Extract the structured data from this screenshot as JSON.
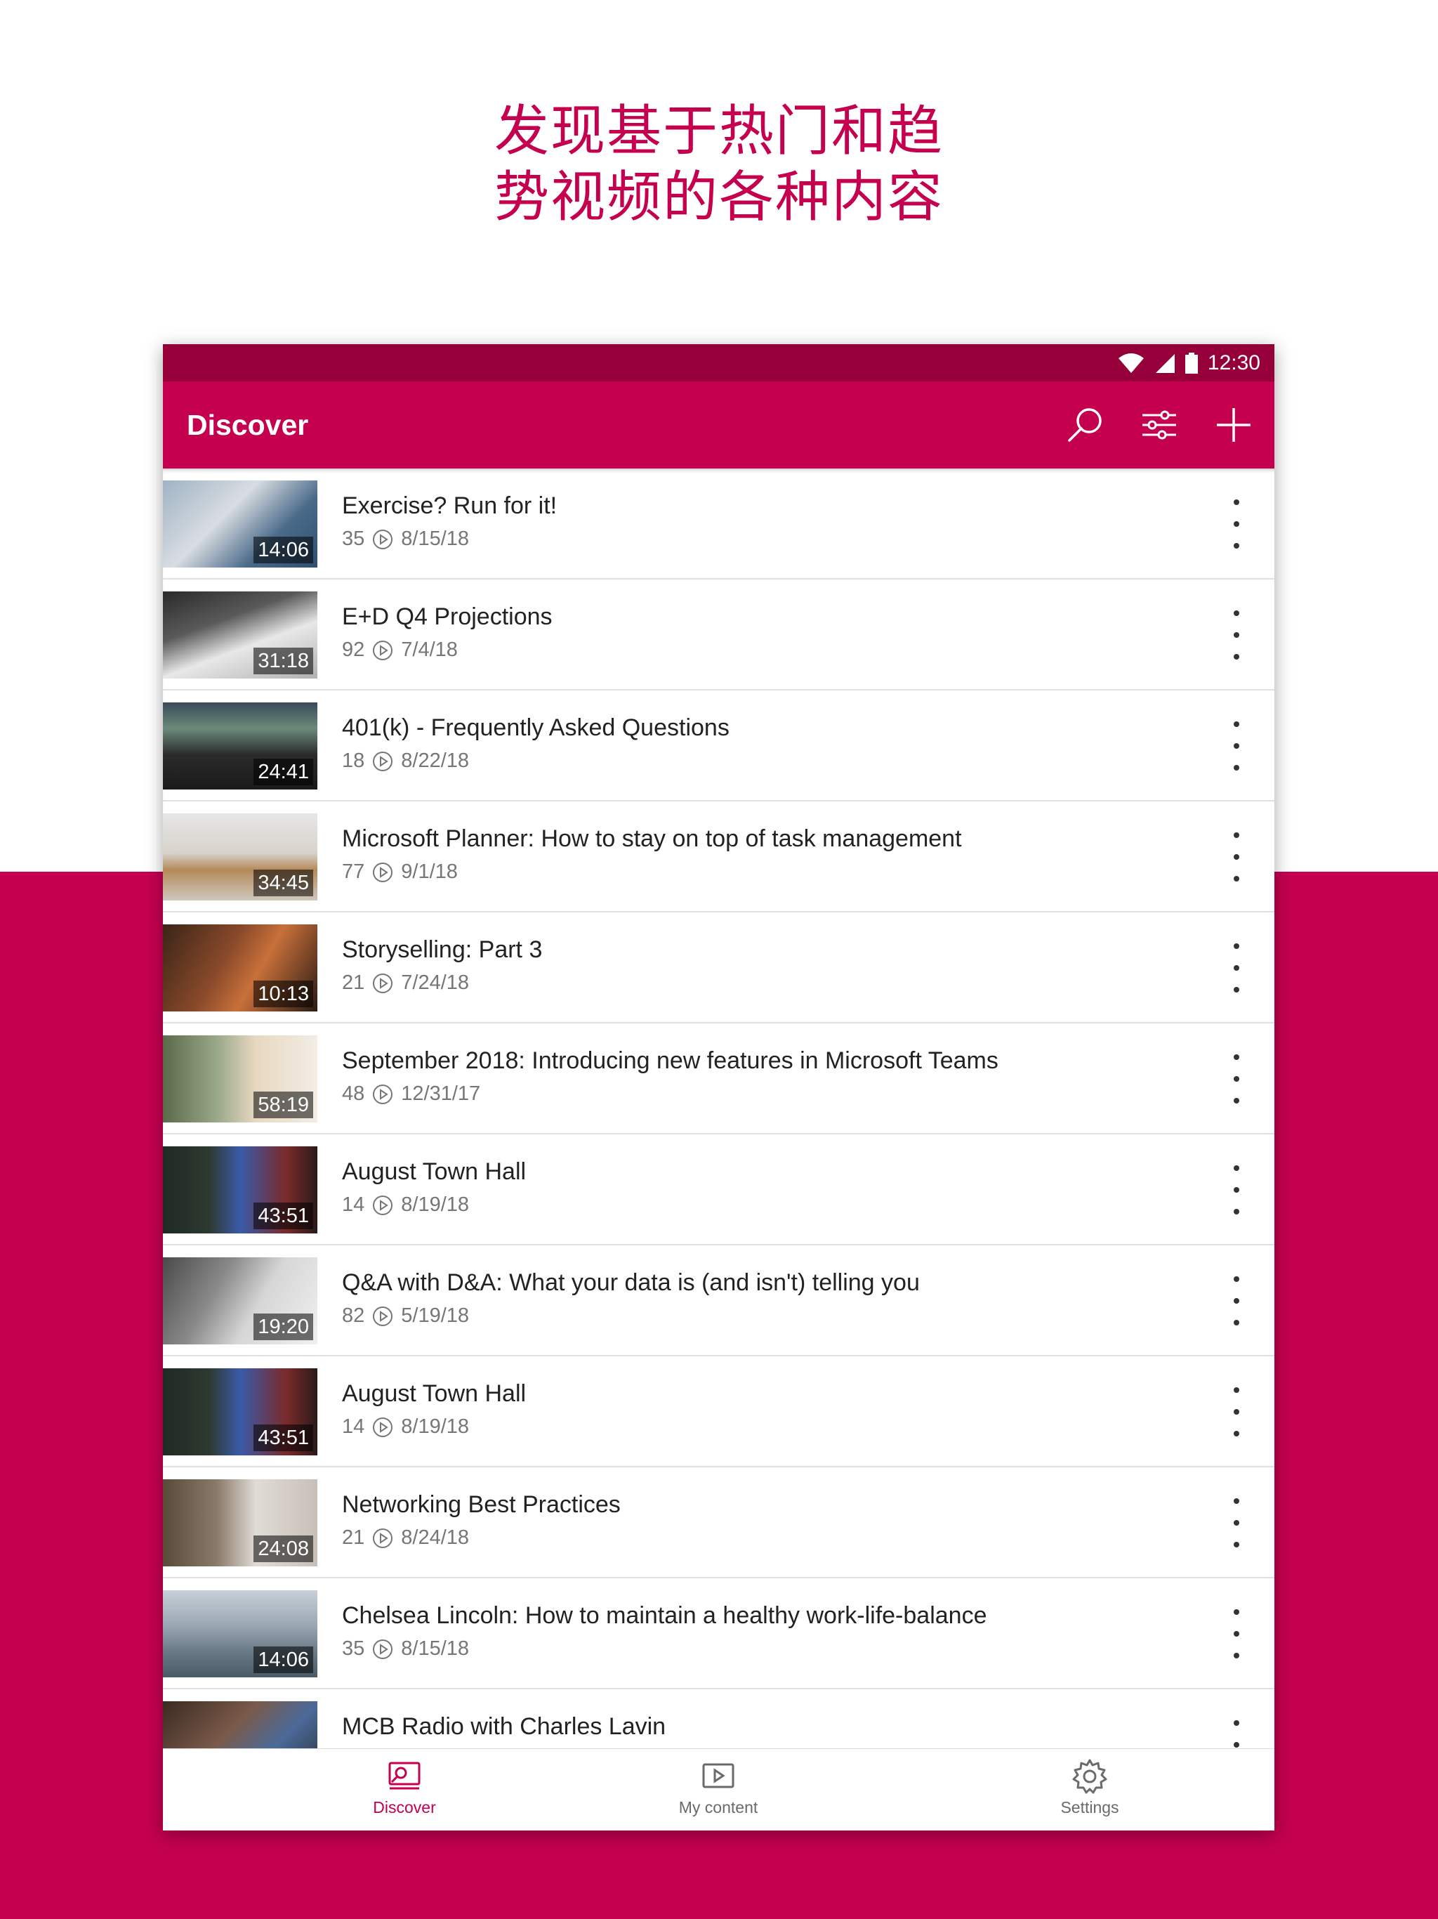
{
  "headline": {
    "line1": "发现基于热门和趋",
    "line2": "势视频的各种内容"
  },
  "status_bar": {
    "time": "12:30"
  },
  "app_bar": {
    "title": "Discover"
  },
  "videos": [
    {
      "title": "Exercise? Run for it!",
      "views": "35",
      "date": "8/15/18",
      "duration": "14:06"
    },
    {
      "title": "E+D Q4 Projections",
      "views": "92",
      "date": "7/4/18",
      "duration": "31:18"
    },
    {
      "title": "401(k) - Frequently Asked Questions",
      "views": "18",
      "date": "8/22/18",
      "duration": "24:41"
    },
    {
      "title": "Microsoft Planner: How to stay on top of task management",
      "views": "77",
      "date": "9/1/18",
      "duration": "34:45"
    },
    {
      "title": "Storyselling: Part 3",
      "views": "21",
      "date": "7/24/18",
      "duration": "10:13"
    },
    {
      "title": "September 2018: Introducing new features in Microsoft Teams",
      "views": "48",
      "date": "12/31/17",
      "duration": "58:19"
    },
    {
      "title": "August Town Hall",
      "views": "14",
      "date": "8/19/18",
      "duration": "43:51"
    },
    {
      "title": "Q&A with D&A: What your data is (and isn't) telling you",
      "views": "82",
      "date": "5/19/18",
      "duration": "19:20"
    },
    {
      "title": "August Town Hall",
      "views": "14",
      "date": "8/19/18",
      "duration": "43:51"
    },
    {
      "title": "Networking Best Practices",
      "views": "21",
      "date": "8/24/18",
      "duration": "24:08"
    },
    {
      "title": "Chelsea Lincoln: How to maintain a healthy work-life-balance",
      "views": "35",
      "date": "8/15/18",
      "duration": "14:06"
    },
    {
      "title": "MCB Radio with Charles Lavin",
      "views": "",
      "date": "",
      "duration": ""
    }
  ],
  "bottom_nav": {
    "discover": "Discover",
    "my_content": "My content",
    "settings": "Settings"
  },
  "colors": {
    "brand": "#c4004f",
    "status_bar": "#95003a"
  }
}
